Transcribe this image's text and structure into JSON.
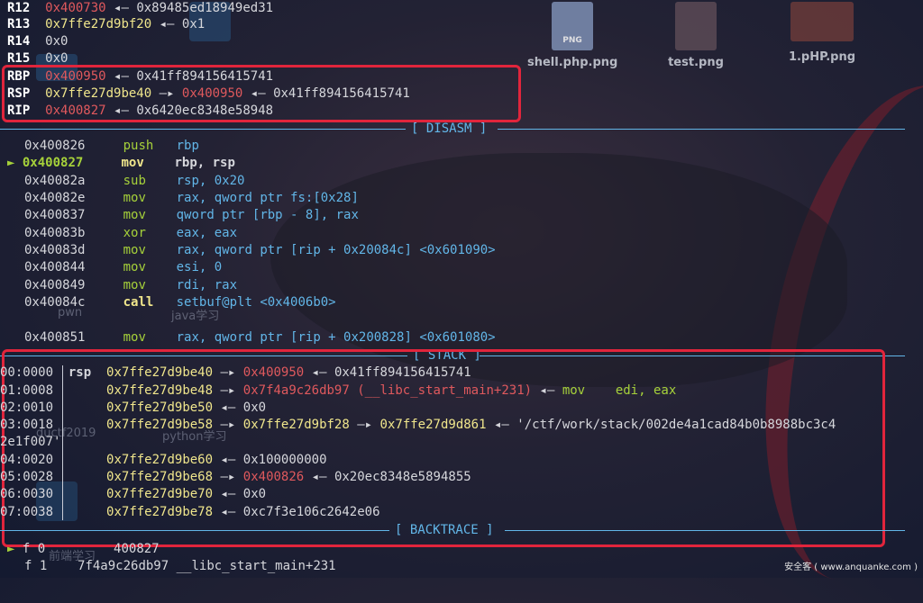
{
  "desktop_icons": [
    {
      "label": "shell.php.png",
      "badge": "PNG"
    },
    {
      "label": "test.png"
    },
    {
      "label": "1.pHP.png"
    }
  ],
  "faint_labels": [
    "pwn",
    "java学习",
    "ductf2019",
    "python学习",
    "前端学习"
  ],
  "registers": [
    {
      "name": "R12",
      "value": "0x400730",
      "arrow": "◂—",
      "target": "0x89485ed18949ed31"
    },
    {
      "name": "R13",
      "value": "0x7ffe27d9bf20",
      "arrow": "◂—",
      "target": "0x1"
    },
    {
      "name": "R14",
      "value": "0x0"
    },
    {
      "name": "R15",
      "value": "0x0"
    },
    {
      "name": "RBP",
      "value": "0x400950",
      "arrow": "◂—",
      "target": "0x41ff894156415741"
    },
    {
      "name": "RSP",
      "value": "0x7ffe27d9be40",
      "arrow": "—▸",
      "target": "0x400950",
      "arrow2": "◂—",
      "target2": "0x41ff894156415741"
    },
    {
      "name": "RIP",
      "value": "0x400827",
      "arrow": "◂—",
      "target": "0x6420ec8348e58948"
    }
  ],
  "sections": {
    "disasm": "[ DISASM ]",
    "stack": "[ STACK ]",
    "backtrace": "[ BACKTRACE ]"
  },
  "disasm": [
    {
      "addr": "0x400826",
      "op": "push",
      "args": "rbp"
    },
    {
      "addr": "0x400827",
      "op": "mov",
      "args": "rbp, rsp",
      "current": true,
      "marker": "►"
    },
    {
      "addr": "0x40082a",
      "op": "sub",
      "args": "rsp, 0x20"
    },
    {
      "addr": "0x40082e",
      "op": "mov",
      "args": "rax, qword ptr fs:[0x28]"
    },
    {
      "addr": "0x400837",
      "op": "mov",
      "args": "qword ptr [rbp - 8], rax"
    },
    {
      "addr": "0x40083b",
      "op": "xor",
      "args": "eax, eax"
    },
    {
      "addr": "0x40083d",
      "op": "mov",
      "args": "rax, qword ptr [rip + 0x20084c] <0x601090>"
    },
    {
      "addr": "0x400844",
      "op": "mov",
      "args": "esi, 0"
    },
    {
      "addr": "0x400849",
      "op": "mov",
      "args": "rdi, rax"
    },
    {
      "addr": "0x40084c",
      "op": "call",
      "args": "setbuf@plt <0x4006b0>"
    },
    {
      "addr": "",
      "op": "",
      "args": ""
    },
    {
      "addr": "0x400851",
      "op": "mov",
      "args": "rax, qword ptr [rip + 0x200828] <0x601080>"
    }
  ],
  "stack": [
    {
      "idx": "00:0000",
      "reg": "rsp",
      "addr": "0x7ffe27d9be40",
      "a1": "—▸",
      "v1": "0x400950",
      "a2": "◂—",
      "v2": "0x41ff894156415741"
    },
    {
      "idx": "01:0008",
      "reg": "",
      "addr": "0x7ffe27d9be48",
      "a1": "—▸",
      "v1": "0x7f4a9c26db97 (__libc_start_main+231)",
      "a2": "◂—",
      "v2": "mov    edi, eax"
    },
    {
      "idx": "02:0010",
      "reg": "",
      "addr": "0x7ffe27d9be50",
      "a1": "◂—",
      "v1": "0x0"
    },
    {
      "idx": "03:0018",
      "reg": "",
      "addr": "0x7ffe27d9be58",
      "a1": "—▸",
      "v1": "0x7ffe27d9bf28",
      "a2": "—▸",
      "v2": "0x7ffe27d9d861",
      "a3": "◂—",
      "v3": "'/ctf/work/stack/002de4a1cad84b0b8988bc3c4"
    },
    {
      "idx": "2e1f007'",
      "reg": "",
      "addr": "",
      "wrap": true
    },
    {
      "idx": "04:0020",
      "reg": "",
      "addr": "0x7ffe27d9be60",
      "a1": "◂—",
      "v1": "0x100000000"
    },
    {
      "idx": "05:0028",
      "reg": "",
      "addr": "0x7ffe27d9be68",
      "a1": "—▸",
      "v1": "0x400826",
      "a2": "◂—",
      "v2": "0x20ec8348e5894855"
    },
    {
      "idx": "06:0030",
      "reg": "",
      "addr": "0x7ffe27d9be70",
      "a1": "◂—",
      "v1": "0x0"
    },
    {
      "idx": "07:0038",
      "reg": "",
      "addr": "0x7ffe27d9be78",
      "a1": "◂—",
      "v1": "0xc7f3e106c2642e06"
    }
  ],
  "backtrace": [
    {
      "marker": "►",
      "frame": "f 0",
      "addr": "400827",
      "sym": ""
    },
    {
      "marker": "",
      "frame": "f 1",
      "addr": "7f4a9c26db97",
      "sym": "__libc_start_main+231"
    }
  ],
  "watermark": "安全客 ( www.anquanke.com )",
  "colors": {
    "highlight_box": "#e1253c",
    "section_rule": "#62b6e8",
    "register_value": "#e0595d",
    "opcode": "#a6d13a"
  }
}
